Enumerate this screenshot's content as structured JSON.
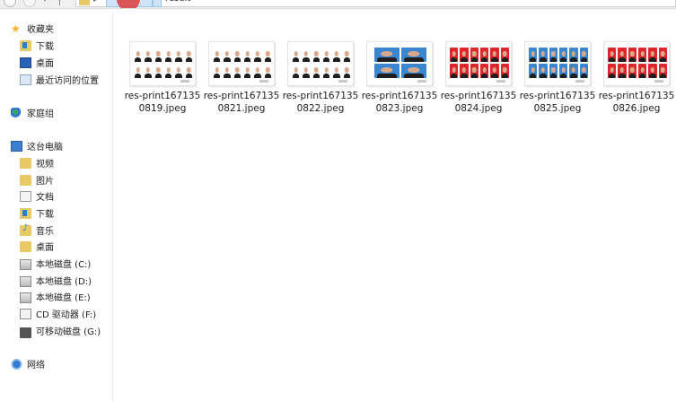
{
  "toolbar": {
    "breadcrumb_current": "result"
  },
  "nav_pane": {
    "favorites": {
      "label": "收藏夹",
      "items": [
        {
          "label": "下载",
          "icon": "download-folder-icon"
        },
        {
          "label": "桌面",
          "icon": "desktop-icon"
        },
        {
          "label": "最近访问的位置",
          "icon": "recent-places-icon"
        }
      ]
    },
    "homegroup": {
      "label": "家庭组",
      "icon": "homegroup-icon"
    },
    "this_pc": {
      "label": "这台电脑",
      "items": [
        {
          "label": "视频",
          "icon": "videos-folder-icon"
        },
        {
          "label": "图片",
          "icon": "pictures-folder-icon"
        },
        {
          "label": "文档",
          "icon": "documents-folder-icon"
        },
        {
          "label": "下载",
          "icon": "download-folder-icon"
        },
        {
          "label": "音乐",
          "icon": "music-folder-icon"
        },
        {
          "label": "桌面",
          "icon": "desktop-icon"
        },
        {
          "label": "本地磁盘 (C:)",
          "icon": "drive-icon"
        },
        {
          "label": "本地磁盘 (D:)",
          "icon": "drive-icon"
        },
        {
          "label": "本地磁盘 (E:)",
          "icon": "drive-icon"
        },
        {
          "label": "CD 驱动器 (F:)",
          "icon": "cd-drive-icon"
        },
        {
          "label": "可移动磁盘 (G:)",
          "icon": "removable-drive-icon"
        }
      ]
    },
    "network": {
      "label": "网络",
      "icon": "network-icon"
    }
  },
  "files": [
    {
      "name": "res-print1671350819.jpeg",
      "background": "#ffffff",
      "layout": "grid"
    },
    {
      "name": "res-print1671350821.jpeg",
      "background": "#ffffff",
      "layout": "grid"
    },
    {
      "name": "res-print1671350822.jpeg",
      "background": "#ffffff",
      "layout": "grid"
    },
    {
      "name": "res-print1671350823.jpeg",
      "background": "#3a86d0",
      "layout": "big"
    },
    {
      "name": "res-print1671350824.jpeg",
      "background": "#e0262b",
      "layout": "grid"
    },
    {
      "name": "res-print1671350825.jpeg",
      "background": "#3a86d0",
      "layout": "grid"
    },
    {
      "name": "res-print1671350826.jpeg",
      "background": "#e0262b",
      "layout": "grid"
    }
  ],
  "colors": {
    "accent_selection": "#cfe4f7",
    "folder": "#e9c866",
    "cursor_highlight": "#dc3c3c"
  }
}
